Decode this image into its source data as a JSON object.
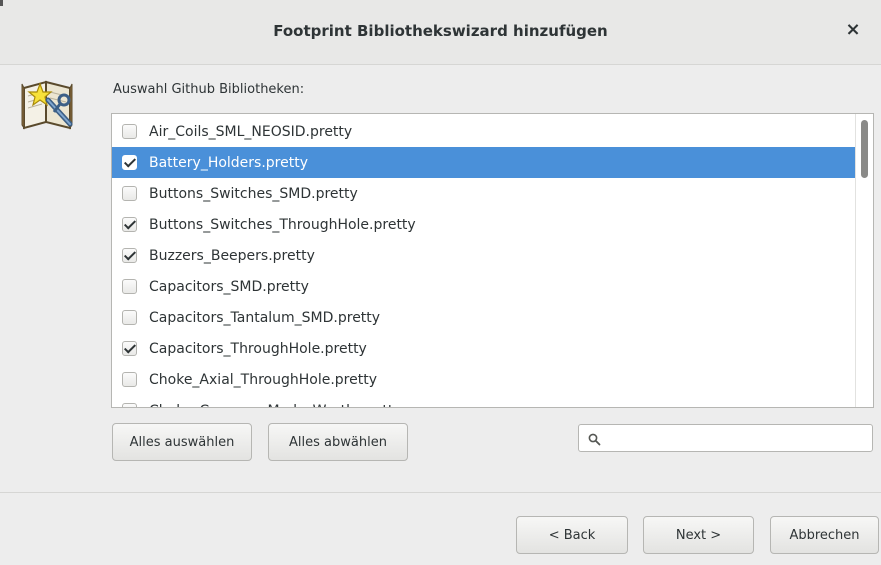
{
  "window": {
    "title": "Footprint Bibliothekswizard hinzufügen",
    "close_glyph": "×"
  },
  "icons": {
    "wizard": "wizard-book-wand-icon",
    "search": "search-icon",
    "close": "close-icon"
  },
  "library_list": {
    "label": "Auswahl Github Bibliotheken:",
    "items": [
      {
        "name": "Air_Coils_SML_NEOSID.pretty",
        "checked": false,
        "selected": false
      },
      {
        "name": "Battery_Holders.pretty",
        "checked": true,
        "selected": true
      },
      {
        "name": "Buttons_Switches_SMD.pretty",
        "checked": false,
        "selected": false
      },
      {
        "name": "Buttons_Switches_ThroughHole.pretty",
        "checked": true,
        "selected": false
      },
      {
        "name": "Buzzers_Beepers.pretty",
        "checked": true,
        "selected": false
      },
      {
        "name": "Capacitors_SMD.pretty",
        "checked": false,
        "selected": false
      },
      {
        "name": "Capacitors_Tantalum_SMD.pretty",
        "checked": false,
        "selected": false
      },
      {
        "name": "Capacitors_ThroughHole.pretty",
        "checked": true,
        "selected": false
      },
      {
        "name": "Choke_Axial_ThroughHole.pretty",
        "checked": false,
        "selected": false
      },
      {
        "name": "Choke_Common-Mode_Wurth.pretty",
        "checked": false,
        "selected": false
      }
    ]
  },
  "buttons": {
    "select_all": "Alles auswählen",
    "deselect_all": "Alles abwählen",
    "back": "< Back",
    "next": "Next >",
    "cancel": "Abbrechen"
  },
  "search": {
    "value": "",
    "placeholder": ""
  },
  "colors": {
    "selection": "#4a90d9",
    "window_bg": "#ededed"
  }
}
